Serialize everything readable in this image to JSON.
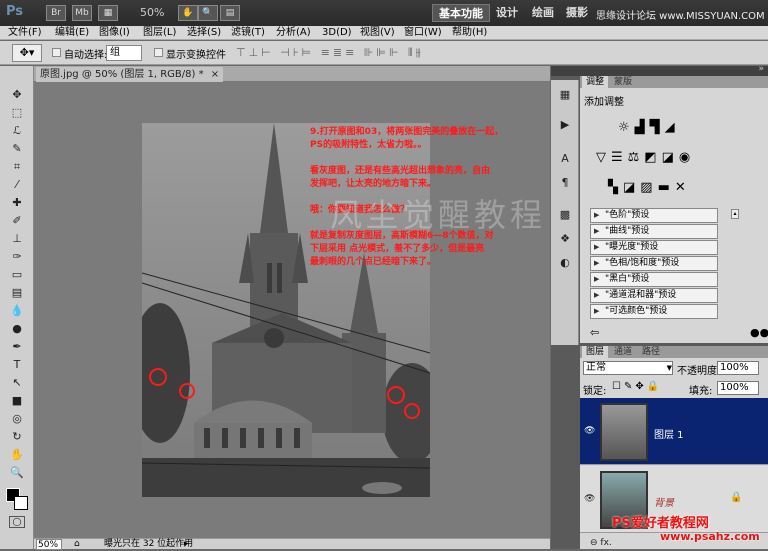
{
  "appbar": {
    "logo": "Ps",
    "btn_br": "Br",
    "btn_mb": "Mb",
    "zoom": "50%",
    "workspaces": [
      "基本功能",
      "设计",
      "绘画",
      "摄影"
    ],
    "watermark": "思缘设计论坛 www.MISSYUAN.COM"
  },
  "menu": [
    "文件(F)",
    "编辑(E)",
    "图像(I)",
    "图层(L)",
    "选择(S)",
    "滤镜(T)",
    "分析(A)",
    "3D(D)",
    "视图(V)",
    "窗口(W)",
    "帮助(H)"
  ],
  "options": {
    "auto_select_label": "自动选择:",
    "auto_select_value": "组",
    "show_transform_label": "显示变换控件"
  },
  "document": {
    "tab_title": "原图.jpg @ 50% (图层 1, RGB/8) *",
    "close": "×",
    "instructions": [
      "9.打开原图和03，将两张图完美的叠放在一起，",
      "PS的吸附特性，太省力啦。。",
      "",
      "看灰度图，还是有些高光超出想象的亮，自由",
      "发挥吧，让太亮的地方暗下来。",
      "",
      "哦：你要知道我怎么做？",
      "",
      "就是复制灰度图层，高斯模糊6—8个数值，对",
      "下层采用 点光模式，羞不了多少，但是最亮",
      "最刺眼的几个点已经暗下来了。"
    ],
    "watermark": "风尘觉醒教程"
  },
  "status": {
    "zoom": "50%",
    "info": "曝光只在 32 位起作用"
  },
  "adjustments": {
    "tabs": [
      "调整",
      "蒙版"
    ],
    "title": "添加调整",
    "presets": [
      "\"色阶\"预设",
      "\"曲线\"预设",
      "\"曝光度\"预设",
      "\"色相/饱和度\"预设",
      "\"黑白\"预设",
      "\"通道混和器\"预设",
      "\"可选颜色\"预设"
    ]
  },
  "layers": {
    "tabs": [
      "图层",
      "通道",
      "路径"
    ],
    "blend_mode": "正常",
    "opacity_label": "不透明度:",
    "opacity": "100%",
    "lock_label": "锁定:",
    "fill_label": "填充:",
    "fill": "100%",
    "items": [
      {
        "name": "图层 1"
      },
      {
        "name": "背景"
      }
    ]
  },
  "footer_watermark": "PS爱好者教程网",
  "footer_url": "www.psahz.com",
  "colors": {
    "selected_layer": "#0b2472",
    "annotation_red": "#ff1a1a"
  }
}
